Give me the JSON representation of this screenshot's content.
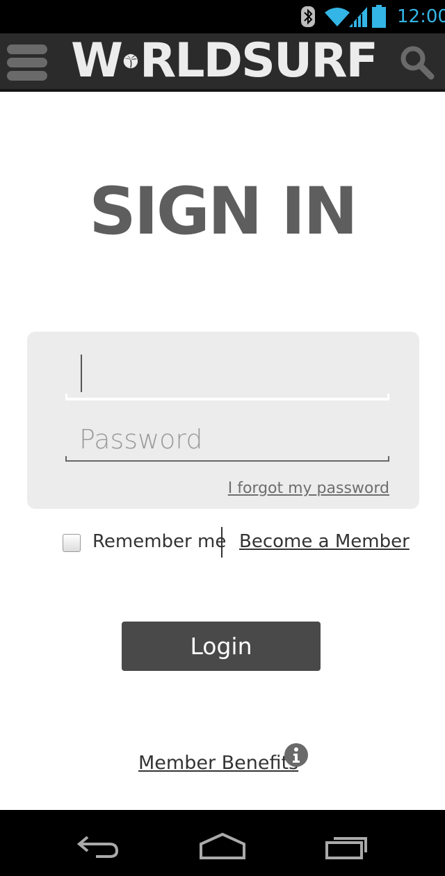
{
  "status_bar": {
    "time": "12:00",
    "icons": [
      "bluetooth-icon",
      "wifi-icon",
      "signal-icon",
      "battery-icon"
    ],
    "accent_color": "#33b5e5"
  },
  "app_bar": {
    "logo_text_left": "W",
    "logo_text_right": "RLDSURF",
    "menu_icon": "hamburger-menu-icon",
    "search_icon": "search-icon"
  },
  "page": {
    "title": "SIGN IN"
  },
  "form": {
    "username_value": "",
    "password_placeholder": "Password",
    "forgot_link": "I forgot my password",
    "remember_label": "Remember me",
    "remember_checked": false,
    "become_member_link": "Become a Member",
    "login_button": "Login"
  },
  "footer": {
    "benefits_link": "Member Benefits",
    "info_icon": "info-icon"
  },
  "nav_bar": {
    "icons": [
      "back-icon",
      "home-icon",
      "recent-apps-icon"
    ]
  },
  "colors": {
    "app_bar": "#2b2b2b",
    "panel": "#ececec",
    "button": "#494949",
    "title": "#5e5e5e"
  }
}
